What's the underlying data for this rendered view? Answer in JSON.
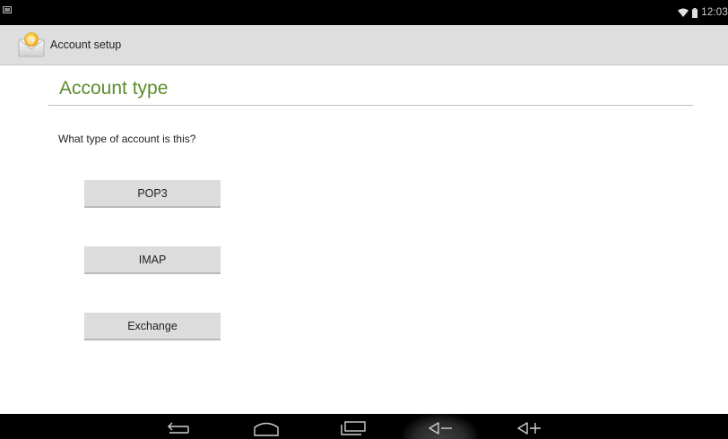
{
  "status_bar": {
    "time": "12:03",
    "left_icon": "screenshot-notification-icon",
    "wifi_icon": "wifi-icon",
    "battery_icon": "battery-icon"
  },
  "action_bar": {
    "title": "Account setup",
    "app_icon": "email-app-icon"
  },
  "main": {
    "heading": "Account type",
    "question": "What type of account is this?",
    "options": [
      {
        "label": "POP3"
      },
      {
        "label": "IMAP"
      },
      {
        "label": "Exchange"
      }
    ]
  },
  "nav_bar": {
    "buttons": [
      "back-icon",
      "home-icon",
      "recent-apps-icon",
      "volume-down-icon",
      "volume-up-icon"
    ]
  },
  "colors": {
    "heading": "#5b8c2c",
    "button_bg": "#dcdcdc",
    "action_bar_bg": "#dedede",
    "system_bars": "#000000"
  }
}
